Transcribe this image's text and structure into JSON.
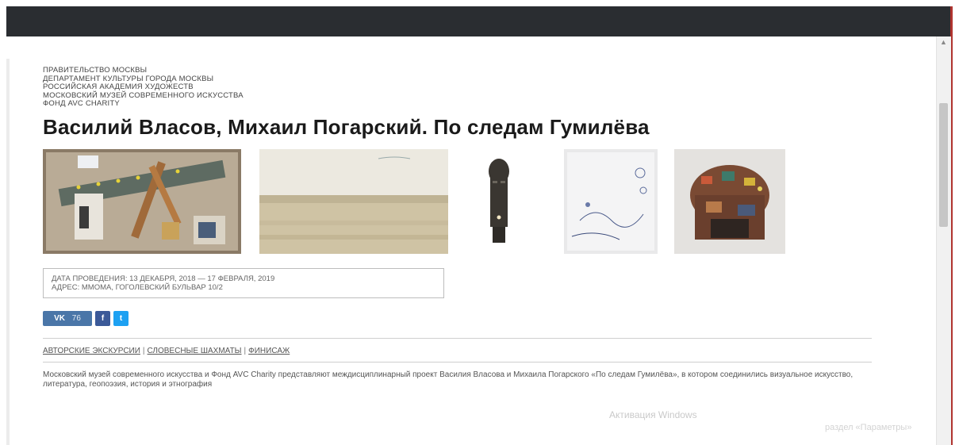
{
  "organizers": [
    "ПРАВИТЕЛЬСТВО МОСКВЫ",
    "ДЕПАРТАМЕНТ КУЛЬТУРЫ ГОРОДА МОСКВЫ",
    "РОССИЙСКАЯ АКАДЕМИЯ ХУДОЖЕСТВ",
    "МОСКОВСКИЙ МУЗЕЙ СОВРЕМЕННОГО ИСКУССТВА",
    "ФОНД AVC CHARITY"
  ],
  "title": "Василий Власов, Михаил Погарский. По следам Гумилёва",
  "gallery": [
    {
      "alt": "artwork-collage"
    },
    {
      "alt": "artwork-landscape"
    },
    {
      "alt": "artwork-mask"
    },
    {
      "alt": "artwork-drawing"
    },
    {
      "alt": "artwork-object"
    }
  ],
  "event": {
    "dates": "ДАТА ПРОВЕДЕНИЯ: 13 ДЕКАБРЯ, 2018 — 17 ФЕВРАЛЯ, 2019",
    "address": "АДРЕС: ММОМА, ГОГОЛЕВСКИЙ БУЛЬВАР 10/2"
  },
  "share": {
    "vk_label": "VK",
    "vk_count": "76",
    "facebook_label": "f",
    "twitter_label": "t",
    "colors": {
      "vk": "#4a76a8",
      "facebook": "#3b5998",
      "twitter": "#1da1f2"
    }
  },
  "links": [
    "АВТОРСКИЕ ЭКСКУРСИИ",
    "СЛОВЕСНЫЕ ШАХМАТЫ",
    "ФИНИСАЖ"
  ],
  "description": "Московский музей современного искусства и Фонд AVC Charity представляют междисциплинарный проект Василия Власова и Михаила Погарского «По следам Гумилёва», в котором соединились визуальное искусство, литература, геопоэзия, история и этнография",
  "watermark": {
    "line1": "Активация Windows",
    "line2": "раздел «Параметры»"
  }
}
